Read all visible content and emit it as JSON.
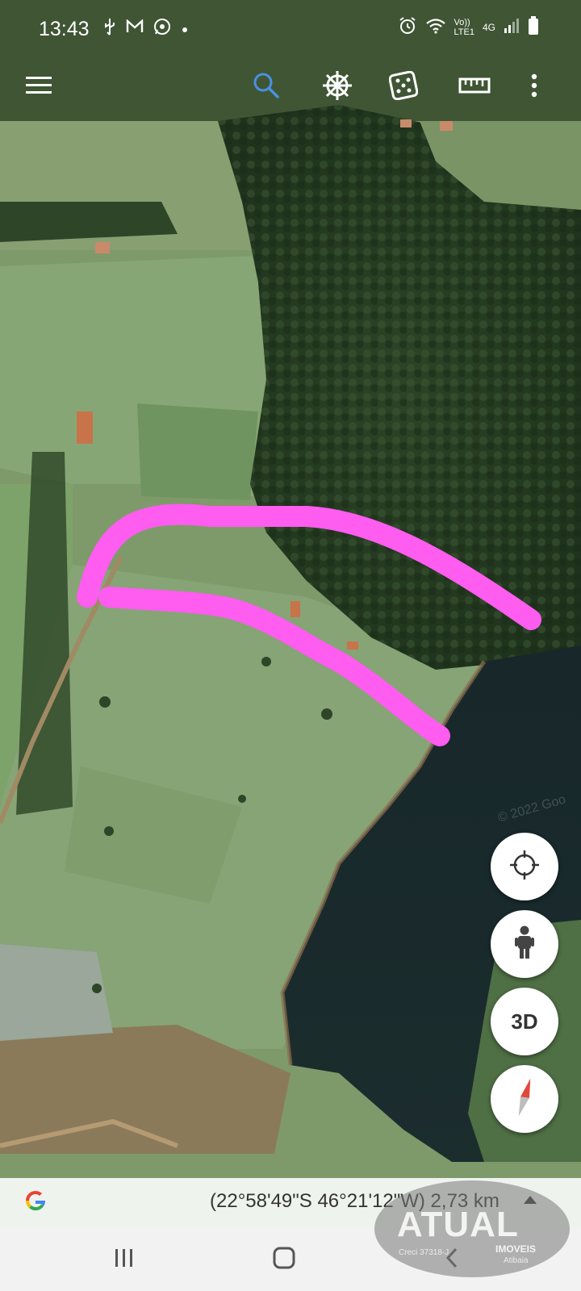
{
  "status_bar": {
    "time": "13:43",
    "left_icons": [
      "usb-icon",
      "gmail-icon",
      "whatsapp-icon",
      "dot-icon"
    ],
    "right_icons": [
      "alarm-icon",
      "wifi-icon",
      "volte-icon",
      "4g-icon",
      "signal-icon",
      "battery-icon"
    ],
    "volte_line1": "Vo))",
    "volte_line2": "LTE1",
    "network": "4G"
  },
  "toolbar": {
    "icons": [
      "menu-icon",
      "search-icon",
      "voyager-wheel-icon",
      "dice-icon",
      "ruler-icon",
      "more-icon"
    ],
    "search_color": "#4a90e2"
  },
  "map": {
    "annotation_color": "#ff5cf0",
    "credit": "© 2022 Goo"
  },
  "side_buttons": {
    "locate_icon": "crosshair-icon",
    "street_view_icon": "pegman-icon",
    "view_3d_label": "3D",
    "compass_icon": "compass-icon"
  },
  "bottom_bar": {
    "logo": "G",
    "coordinates": "(22°58'49\"S 46°21'12\"W) 2,73 km"
  },
  "watermark": {
    "brand": "ATUAL",
    "sub": "IMOVEIS",
    "city": "Atibaia",
    "creci": "Creci 37318-J"
  },
  "nav_bar": {
    "icons": [
      "recents-icon",
      "home-icon",
      "back-icon"
    ]
  }
}
